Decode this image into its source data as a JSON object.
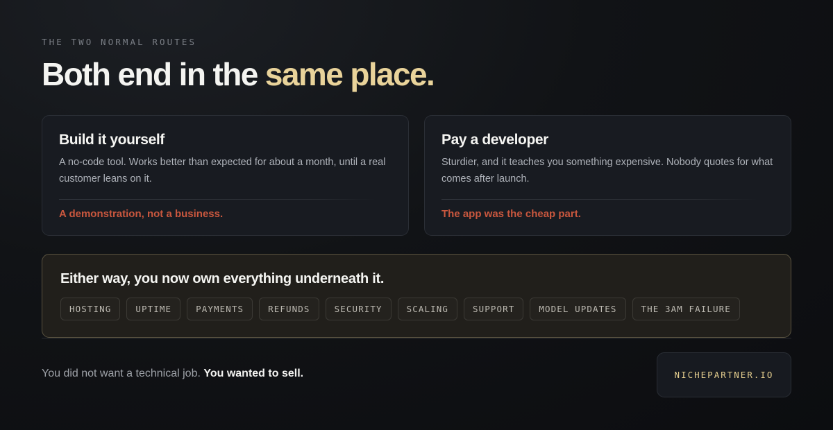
{
  "eyebrow": "THE TWO NORMAL ROUTES",
  "headline": {
    "lead": "Both end in the ",
    "accent": "same place."
  },
  "routes": [
    {
      "title": "Build it yourself",
      "body": "A no-code tool. Works better than expected for about a month, until a real customer leans on it.",
      "verdict": "A demonstration, not a business."
    },
    {
      "title": "Pay a developer",
      "body": "Sturdier, and it teaches you something expensive. Nobody quotes for what comes after launch.",
      "verdict": "The app was the cheap part."
    }
  ],
  "ownership": {
    "title": "Either way, you now own everything underneath it.",
    "tags": [
      "HOSTING",
      "UPTIME",
      "PAYMENTS",
      "REFUNDS",
      "SECURITY",
      "SCALING",
      "SUPPORT",
      "MODEL UPDATES",
      "THE 3AM FAILURE"
    ]
  },
  "footer": {
    "text": "You did not want a technical job. ",
    "emphasis": "You wanted to sell."
  },
  "brand": "NICHEPARTNER.IO",
  "colors": {
    "accent": "#e9d39a",
    "warning": "#c9573e",
    "panel_border": "#5a5340"
  }
}
